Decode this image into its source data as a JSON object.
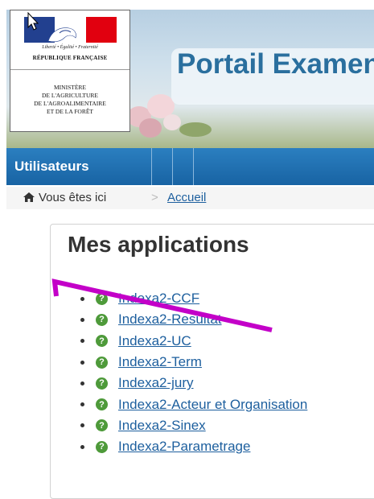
{
  "logo": {
    "motto": "Liberté • Égalité • Fraternité",
    "republic": "RÉPUBLIQUE FRANÇAISE",
    "ministry_lines": [
      "MINISTÈRE",
      "DE L'AGRICULTURE",
      "DE L'AGROALIMENTAIRE",
      "ET DE LA FORÊT"
    ]
  },
  "header": {
    "title": "Portail Examen"
  },
  "nav": {
    "items": [
      {
        "label": "Utilisateurs"
      }
    ]
  },
  "breadcrumb": {
    "prefix": "Vous êtes ici",
    "separator": ">",
    "current": "Accueil",
    "icon": "home-icon"
  },
  "panel": {
    "title": "Mes applications",
    "items": [
      {
        "label": "Indexa2-CCF",
        "icon": "help-icon"
      },
      {
        "label": "Indexa2-Resultat",
        "icon": "help-icon"
      },
      {
        "label": "Indexa2-UC",
        "icon": "help-icon"
      },
      {
        "label": "Indexa2-Term",
        "icon": "help-icon"
      },
      {
        "label": "Indexa2-jury",
        "icon": "help-icon"
      },
      {
        "label": "Indexa2-Acteur et Organisation",
        "icon": "help-icon"
      },
      {
        "label": "Indexa2-Sinex",
        "icon": "help-icon"
      },
      {
        "label": "Indexa2-Parametrage",
        "icon": "help-icon"
      }
    ]
  },
  "colors": {
    "nav_blue": "#1d6fb0",
    "link_blue": "#1d5f9e",
    "help_green": "#4e9a3a",
    "annotation_magenta": "#c300c8",
    "flag_blue": "#22408f",
    "flag_red": "#e1000f"
  }
}
